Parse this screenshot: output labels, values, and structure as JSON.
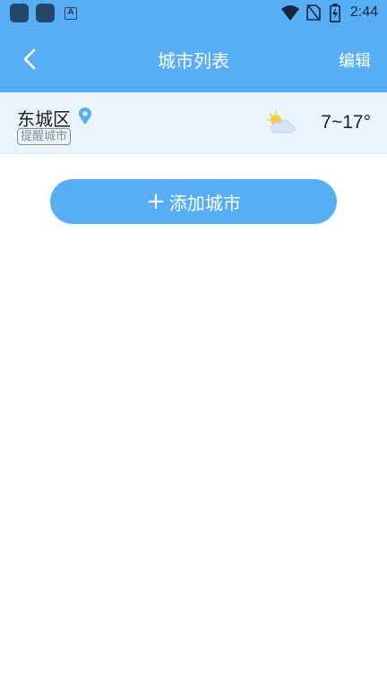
{
  "status_bar": {
    "time": "2:44",
    "notification_letter": "A",
    "icons": [
      "app-icon",
      "app-icon",
      "accessibility-a-icon",
      "wifi-icon",
      "no-sim-icon",
      "battery-charging-icon"
    ]
  },
  "nav": {
    "back_icon": "chevron-left-icon",
    "title": "城市列表",
    "edit_label": "编辑"
  },
  "cities": [
    {
      "name": "东城区",
      "location_icon": "location-pin-icon",
      "badge": "提醒城市",
      "weather_icon": "partly-cloudy-icon",
      "temperature": "7~17°"
    }
  ],
  "add_city": {
    "icon": "plus-icon",
    "label": "添加城市"
  },
  "colors": {
    "primary": "#57aef5",
    "row_background": "#eaf4fd",
    "status_icon": "#24466a"
  }
}
